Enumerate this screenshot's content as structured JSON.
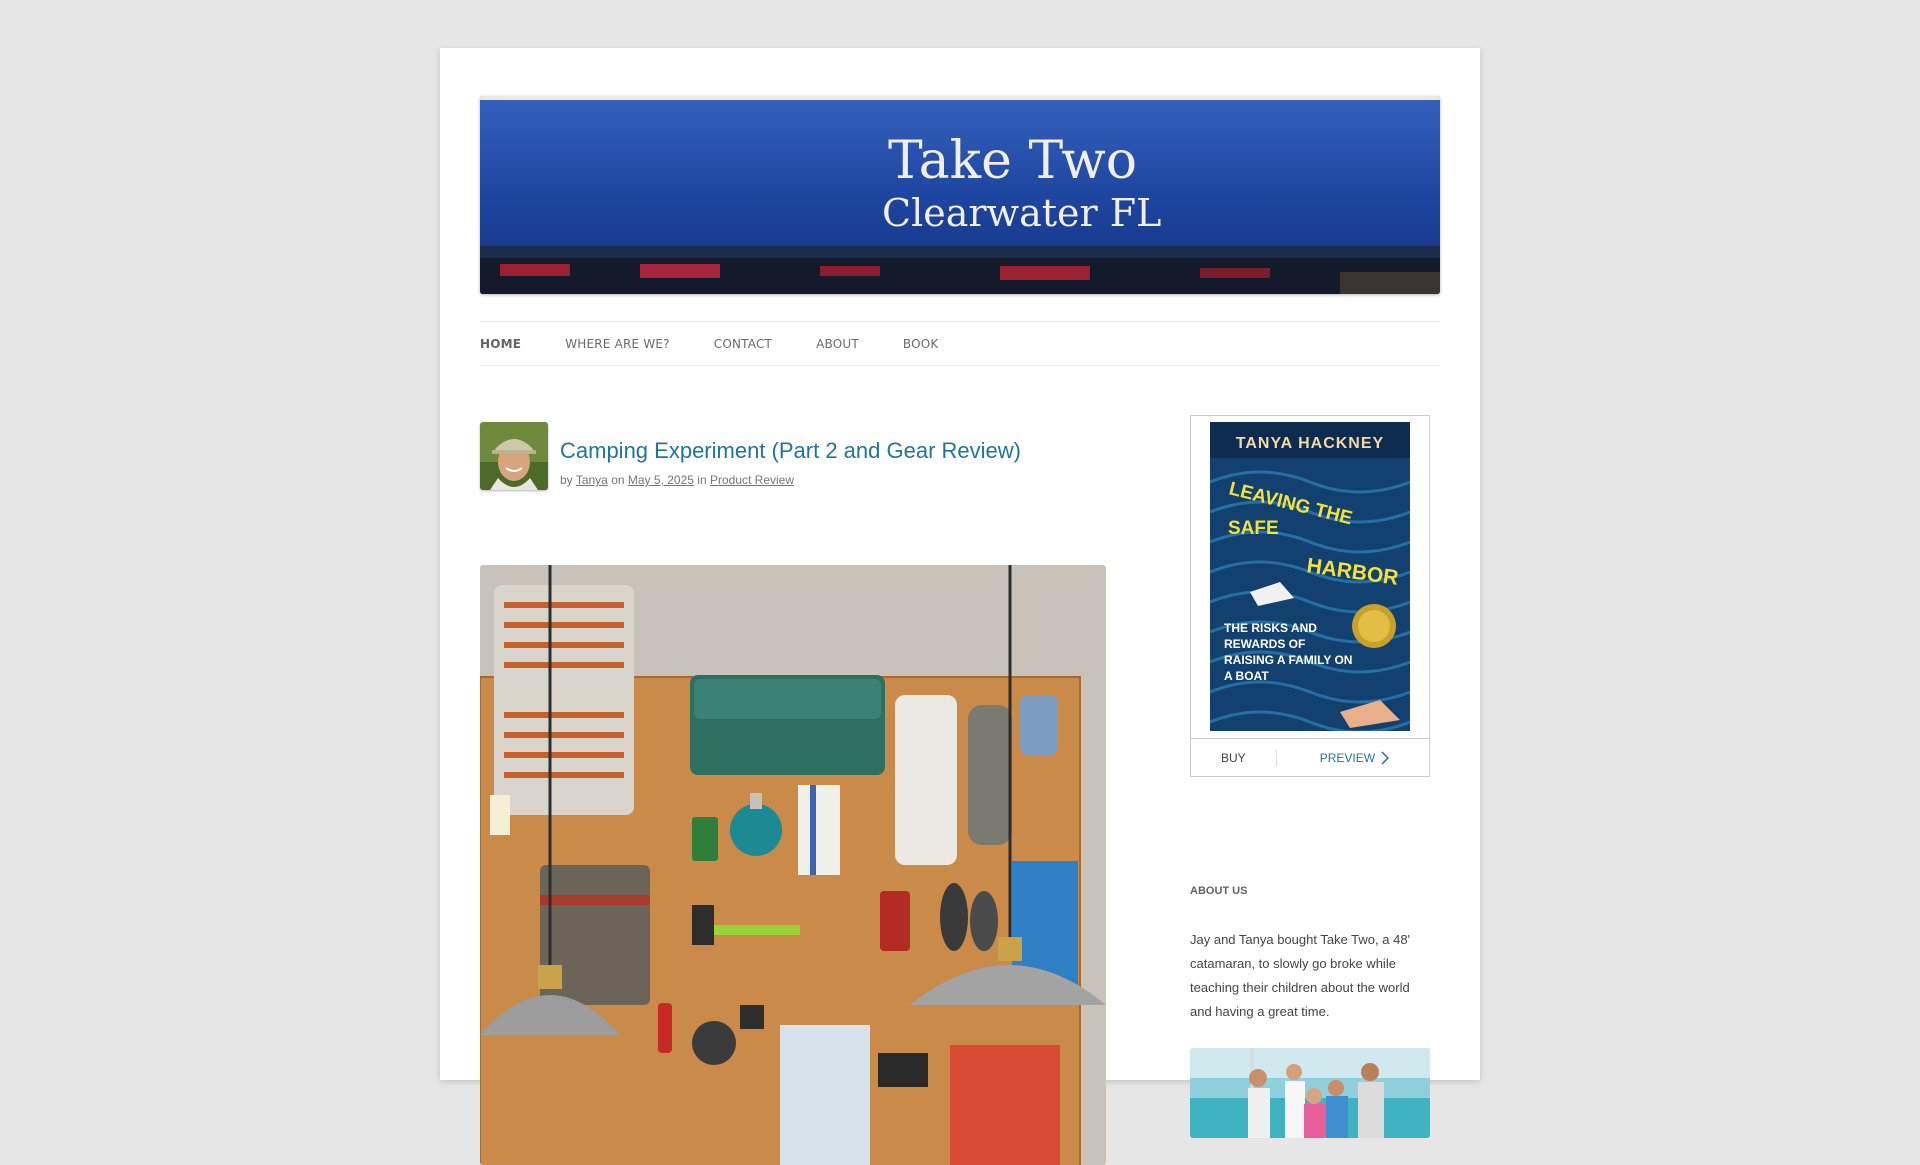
{
  "header": {
    "banner_line1": "Take Two",
    "banner_line2": "Clearwater FL"
  },
  "nav": {
    "items": [
      {
        "label": "HOME"
      },
      {
        "label": "WHERE ARE WE?"
      },
      {
        "label": "CONTACT"
      },
      {
        "label": "ABOUT"
      },
      {
        "label": "BOOK"
      }
    ]
  },
  "article": {
    "title": "Camping Experiment (Part 2 and Gear Review)",
    "meta_by": "by",
    "author": "Tanya",
    "meta_on": "on",
    "date": "May 5, 2025",
    "meta_in": "in",
    "category": "Product Review"
  },
  "sidebar": {
    "book": {
      "author": "TANYA HACKNEY",
      "title_line1": "LEAVING THE",
      "title_line2": "SAFE",
      "title_line3": "HARBOR",
      "subtitle": "THE RISKS AND REWARDS OF RAISING A FAMILY ON A BOAT",
      "buy_label": "BUY",
      "preview_label": "PREVIEW"
    },
    "about": {
      "title": "ABOUT US",
      "text": "Jay and Tanya bought Take Two, a 48' catamaran, to slowly go broke while teaching their children about the world and having a great time."
    }
  },
  "colors": {
    "link": "#21759b",
    "banner_blue": "#2a4fa8",
    "page_bg": "#e6e6e6"
  }
}
